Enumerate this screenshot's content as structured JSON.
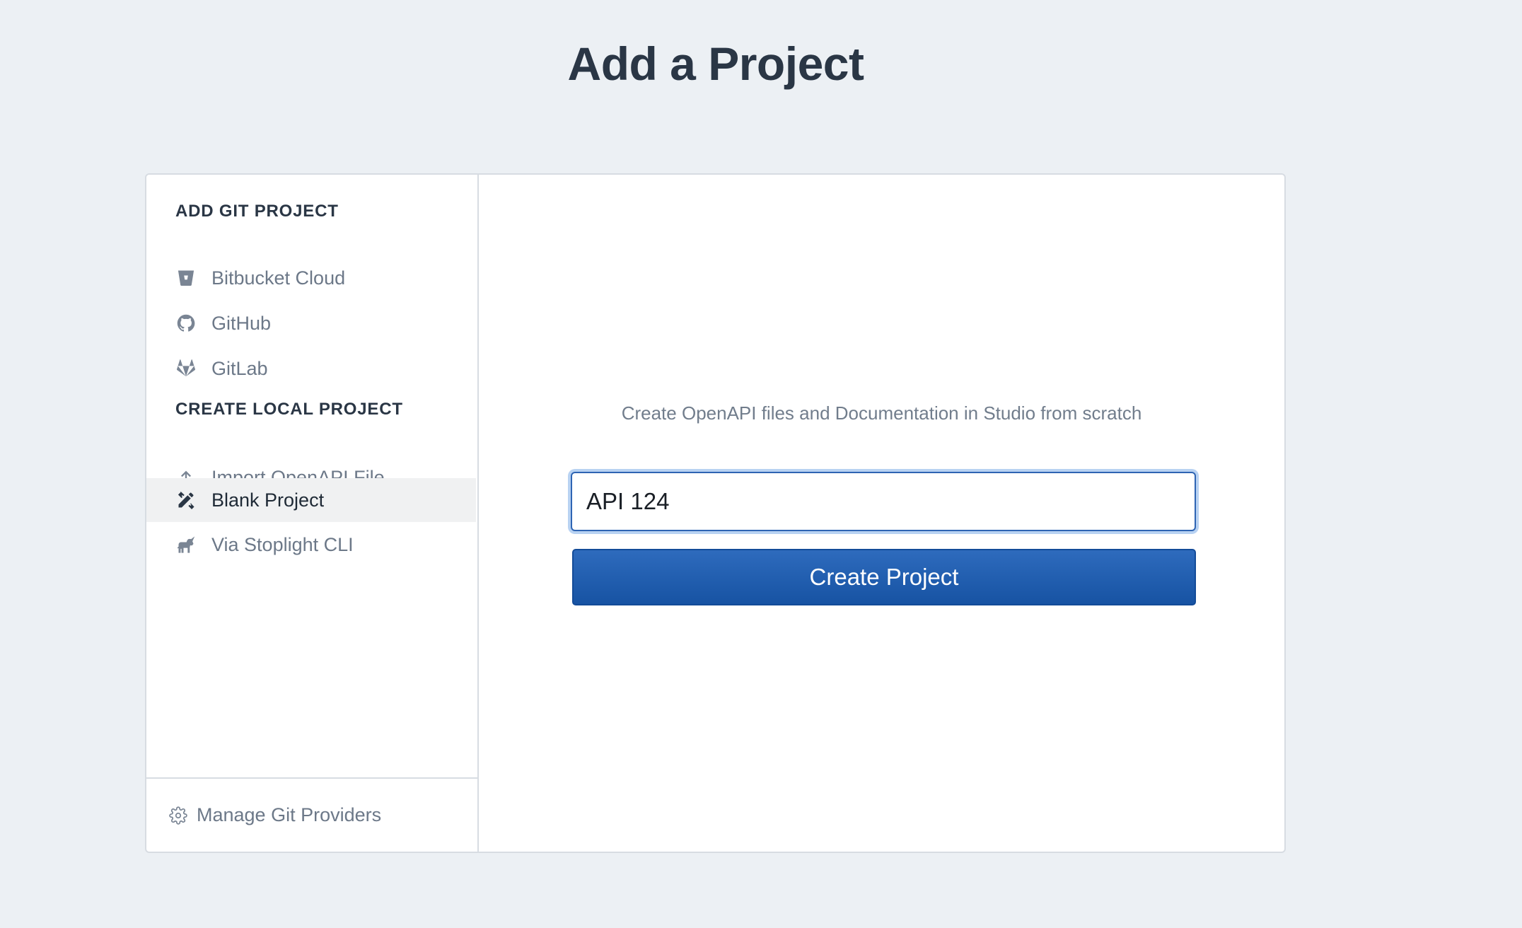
{
  "page": {
    "title": "Add a Project"
  },
  "sidebar": {
    "git_section_heading": "ADD GIT PROJECT",
    "git_items": [
      {
        "label": "Bitbucket Cloud",
        "icon": "bitbucket-icon"
      },
      {
        "label": "GitHub",
        "icon": "github-icon"
      },
      {
        "label": "GitLab",
        "icon": "gitlab-icon"
      }
    ],
    "local_section_heading": "CREATE LOCAL PROJECT",
    "local_items": [
      {
        "label": "Import OpenAPI File",
        "icon": "upload-icon"
      },
      {
        "label": "Blank Project",
        "icon": "pencil-ruler-icon",
        "active": true
      },
      {
        "label": "Via Stoplight CLI",
        "icon": "unicorn-icon"
      }
    ],
    "footer_label": "Manage Git Providers",
    "footer_icon": "gear-icon"
  },
  "main": {
    "description": "Create OpenAPI files and Documentation in Studio from scratch",
    "project_name_value": "API 124",
    "create_button_label": "Create Project"
  },
  "colors": {
    "background": "#ecf0f4",
    "primary": "#1d5eb0",
    "heading_text": "#2a3645",
    "muted_text": "#6c7888",
    "active_item_bg": "#f0f1f2"
  }
}
